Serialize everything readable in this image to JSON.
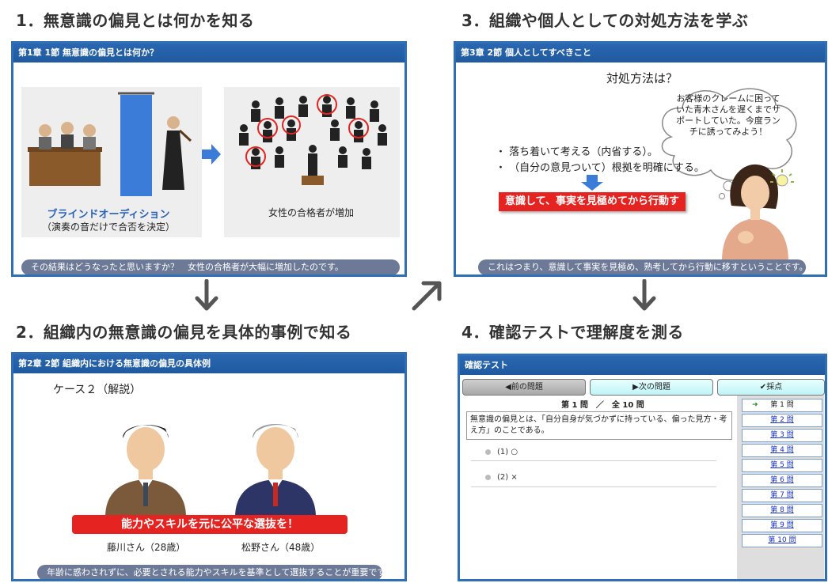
{
  "steps": [
    {
      "number": "1",
      "title": "無意識の偏見とは何かを知る"
    },
    {
      "number": "2",
      "title": "組織内の無意識の偏見を具体的事例で知る"
    },
    {
      "number": "3",
      "title": "組織や個人としての対処方法を学ぶ"
    },
    {
      "number": "4",
      "title": "確認テストで理解度を測る"
    }
  ],
  "panel1": {
    "title": "第1章 1節 無意識の偏見とは何か？",
    "blind_title": "ブラインドオーディション",
    "blind_sub": "（演奏の音だけで合否を決定）",
    "orchestra_caption": "女性の合格者が増加",
    "caption": "その結果はどうなったと思いますか？　女性の合格者が大幅に増加したのです。"
  },
  "panel2": {
    "title": "第2章 2節 組織内における無意識の偏見の具体例",
    "case_label": "ケース２（解説）",
    "banner": "能力やスキルを元に公平な選抜を！",
    "person_left": "藤川さん（28歳）",
    "person_right": "松野さん（48歳）",
    "caption": "年齢に惑わされずに、必要とされる能力やスキルを基準として選抜することが重要です。"
  },
  "panel3": {
    "title": "第3章 2節 個人としてすべきこと",
    "question": "対処方法は？",
    "bullets": [
      "・ 落ち着いて考える（内省する）。",
      "・ （自分の意見ついて）根拠を明確にする。"
    ],
    "red_box": "意識して、事実を見極めてから行動する。",
    "bubble": "お客様のクレームに困っていた青木さんを遅くまでサポートしていた。今度ランチに誘ってみよう！",
    "caption": "これはつまり、意識して事実を見極め、熟考してから行動に移すということです。"
  },
  "panel4": {
    "title": "確認テスト",
    "prev_button": "前の問題",
    "next_button": "次の問題",
    "grade_button": "採点",
    "question_index": "第 1 問　／　全 10 問",
    "question_text": "無意識の偏見とは、「自分自身が気づかずに持っている、偏った見方・考え方」のことである。",
    "options": [
      "(1) ○",
      "(2) ×"
    ],
    "question_list": [
      "第 1 問",
      "第 2 問",
      "第 3 問",
      "第 4 問",
      "第 5 問",
      "第 6 問",
      "第 7 問",
      "第 8 問",
      "第 9 問",
      "第 10 問"
    ]
  },
  "colors": {
    "panel_border": "#2f6fb6",
    "title_bar": "#2a67b0",
    "caption_bar": "#6c7a98",
    "accent_red": "#e52421",
    "arrow": "#555555"
  }
}
